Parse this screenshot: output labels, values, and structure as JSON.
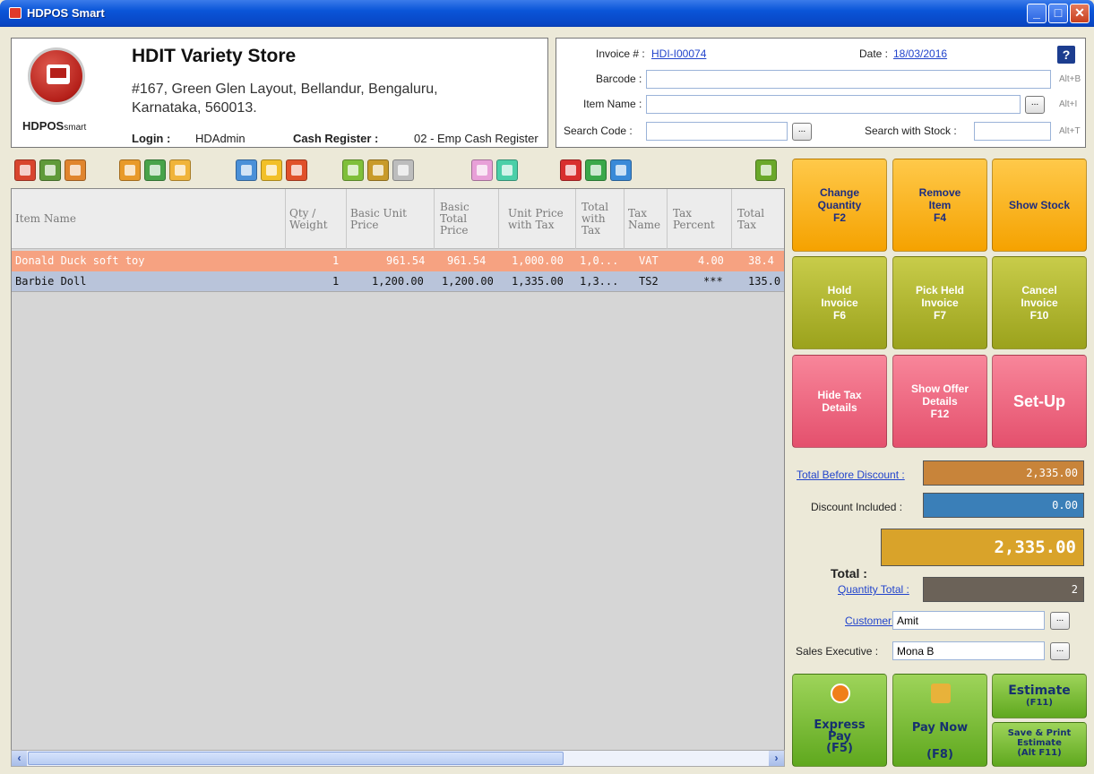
{
  "window": {
    "title": "HDPOS Smart",
    "minimize": "_",
    "maximize": "□",
    "close": "✕"
  },
  "store": {
    "logo_text": "HDPOS",
    "logo_small": "smart",
    "name": "HDIT Variety Store",
    "address_line1": "#167, Green Glen Layout, Bellandur, Bengaluru,",
    "address_line2": "Karnataka, 560013.",
    "login_label": "Login :",
    "login_value": "HDAdmin",
    "cash_register_label": "Cash Register :",
    "cash_register_value": "02 - Emp Cash Register"
  },
  "invoice": {
    "invoice_label": "Invoice # :",
    "invoice_number": "HDI-I00074",
    "date_label": "Date :",
    "date_value": "18/03/2016",
    "help": "?",
    "barcode_label": "Barcode :",
    "barcode_hint": "Alt+B",
    "item_name_label": "Item Name :",
    "item_name_hint": "Alt+I",
    "search_code_label": "Search Code :",
    "search_stock_label": "Search with Stock :",
    "search_stock_hint": "Alt+T",
    "browse": "..."
  },
  "grid": {
    "columns": [
      "Item Name",
      "Qty / Weight",
      "Basic Unit Price",
      "Basic Total Price",
      "Unit Price with Tax",
      "Total with Tax",
      "Tax Name",
      "Tax Percent",
      "Total Tax"
    ],
    "rows": [
      {
        "item": "Donald Duck soft toy",
        "qty": "1",
        "unit": "961.54",
        "basic_total": "961.54",
        "unit_tax": "1,000.00",
        "total_tax": "1,0...",
        "tax_name": "VAT",
        "tax_pct": "4.00",
        "total_tax_amt": "38.4"
      },
      {
        "item": "Barbie Doll",
        "qty": "1",
        "unit": "1,200.00",
        "basic_total": "1,200.00",
        "unit_tax": "1,335.00",
        "total_tax": "1,3...",
        "tax_name": "TS2",
        "tax_pct": "***",
        "total_tax_amt": "135.0"
      }
    ]
  },
  "actions": {
    "change_qty": [
      "Change",
      "Quantity",
      "F2"
    ],
    "remove_item": [
      "Remove",
      "Item",
      "F4"
    ],
    "show_stock": [
      "Show Stock"
    ],
    "hold_invoice": [
      "Hold",
      "Invoice",
      "F6"
    ],
    "pick_held": [
      "Pick Held",
      "Invoice",
      "F7"
    ],
    "cancel_invoice": [
      "Cancel",
      "Invoice",
      "F10"
    ],
    "hide_tax": [
      "Hide Tax",
      "Details"
    ],
    "show_offer": [
      "Show Offer",
      "Details",
      "F12"
    ],
    "setup": [
      "Set-Up"
    ]
  },
  "totals": {
    "before_discount_label": "Total Before Discount :",
    "before_discount_value": "2,335.00",
    "discount_label": "Discount Included :",
    "discount_value": "0.00",
    "total_label": "Total :",
    "total_value": "2,335.00",
    "qty_total_label": "Quantity Total :",
    "qty_total_value": "2",
    "customer_label": "Customer :",
    "customer_value": "Amit",
    "sales_exec_label": "Sales Executive :",
    "sales_exec_value": "Mona B",
    "colors": {
      "before_discount": "#c8843a",
      "discount": "#3a7fb8",
      "total": "#d9a32a",
      "qty_total": "#6b6258"
    }
  },
  "bottom": {
    "express_pay": [
      "Express",
      "Pay",
      "(F5)"
    ],
    "pay_now": [
      "Pay Now",
      "(F8)"
    ],
    "estimate": [
      "Estimate",
      "(F11)"
    ],
    "save_print_estimate": [
      "Save & Print",
      "Estimate",
      "(Alt F11)"
    ]
  }
}
